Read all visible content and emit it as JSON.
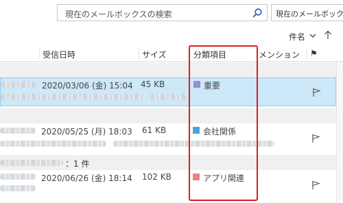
{
  "search": {
    "placeholder": "現在のメールボックスの検索",
    "scope_label": "現在のメールボックス"
  },
  "sort": {
    "label": "件名",
    "direction": "ascending"
  },
  "columns": {
    "received": "受信日時",
    "size": "サイズ",
    "category": "分類項目",
    "mention": "メンション",
    "flag_header": "⚑"
  },
  "groups": [
    {
      "label": ""
    },
    {
      "label": ""
    },
    {
      "label": "：1 件"
    }
  ],
  "messages": [
    {
      "received": "2020/03/06 (金) 15:04",
      "size": "45 KB",
      "category": "重要",
      "category_color": "#9b8cd6",
      "selected": true
    },
    {
      "received": "2020/05/25 (月) 18:03",
      "size": "61 KB",
      "category": "会社関係",
      "category_color": "#4aa3df",
      "selected": false
    },
    {
      "received": "2020/06/26 (金) 18:14",
      "size": "102 KB",
      "category": "アプリ関連",
      "category_color": "#f08080",
      "selected": false
    }
  ],
  "colors": {
    "selection_bg": "#cde8f8",
    "highlight_border": "#e01b1b"
  }
}
